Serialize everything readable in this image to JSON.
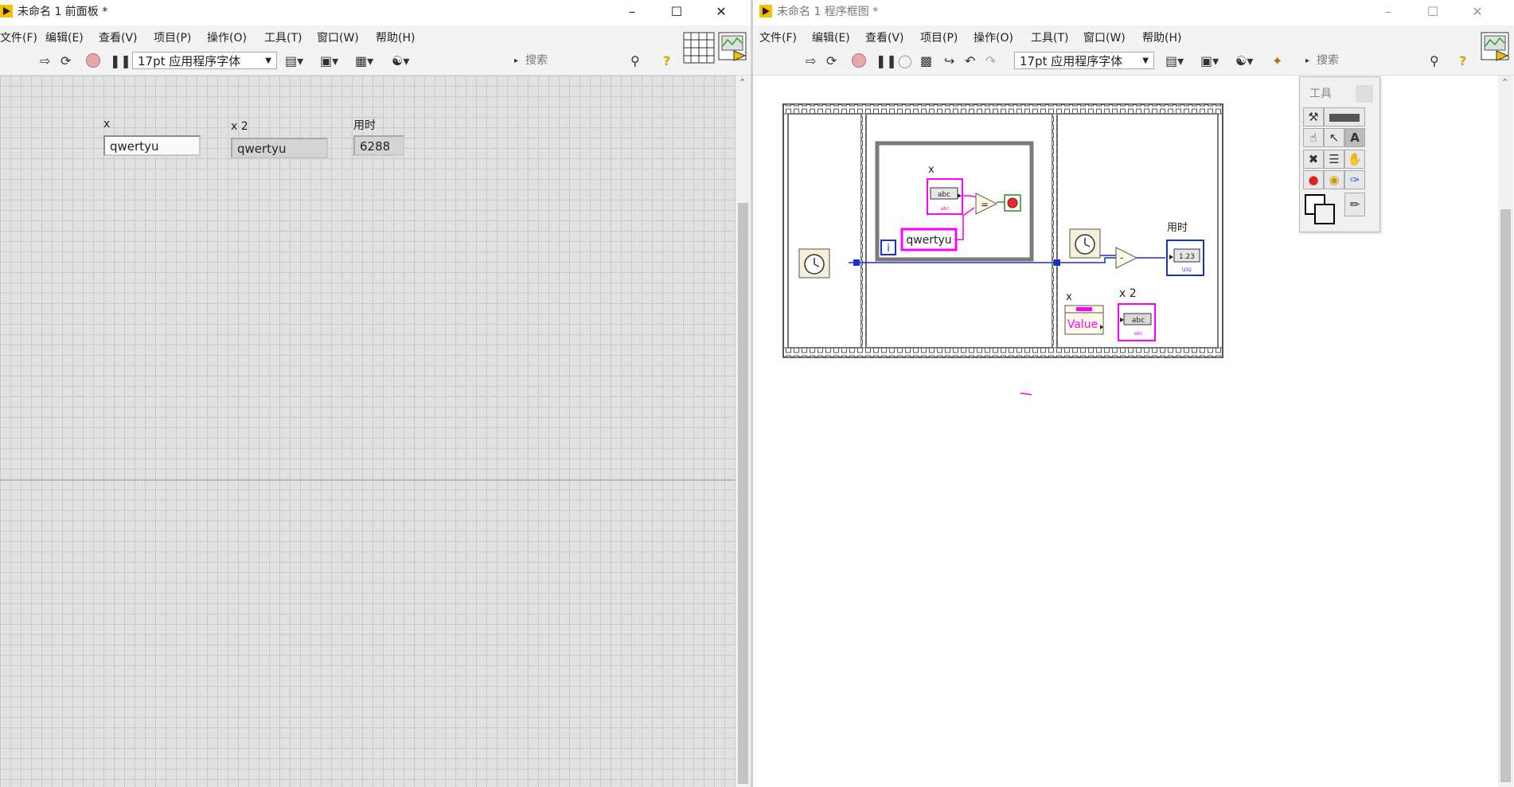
{
  "front_panel": {
    "title": "未命名 1 前面板 *",
    "menu": [
      "文件(F)",
      "编辑(E)",
      "查看(V)",
      "项目(P)",
      "操作(O)",
      "工具(T)",
      "窗口(W)",
      "帮助(H)"
    ],
    "font_select": "17pt 应用程序字体",
    "search_placeholder": "搜索",
    "controls": {
      "x": {
        "label": "x",
        "value": "qwertyu"
      },
      "x2": {
        "label": "x 2",
        "value": "qwertyu"
      },
      "elapsed": {
        "label": "用时",
        "value": "6288"
      }
    }
  },
  "block_diagram": {
    "title": "未命名 1 程序框图 *",
    "menu": [
      "文件(F)",
      "编辑(E)",
      "查看(V)",
      "项目(P)",
      "操作(O)",
      "工具(T)",
      "窗口(W)",
      "帮助(H)"
    ],
    "font_select": "17pt 应用程序字体",
    "search_placeholder": "搜索",
    "nodes": {
      "x_label": "x",
      "x_terminal": "abc",
      "x_terminal_sub": "abc",
      "string_const": "qwertyu",
      "loop_index": "i",
      "elapsed_label": "用时",
      "elapsed_terminal": "1.23",
      "elapsed_terminal_sub": "U32",
      "prop_label": "x",
      "prop_value": "Value",
      "x2_label": "x 2",
      "x2_terminal": "abc",
      "x2_terminal_sub": "abc"
    },
    "tools_palette_title": "工具"
  },
  "colors": {
    "string_wire": "#ff00ff",
    "numeric_wire": "#1a2fd1",
    "frame": "#6a6a6a",
    "grid": "#c9c9c9",
    "panel_bg": "#e1e1e1"
  },
  "icons": [
    "labview-icon",
    "run-icon",
    "run-continuous-icon",
    "abort-icon",
    "pause-icon",
    "highlight-icon",
    "search-icon",
    "help-icon",
    "minimize-icon",
    "maximize-icon",
    "close-icon"
  ]
}
